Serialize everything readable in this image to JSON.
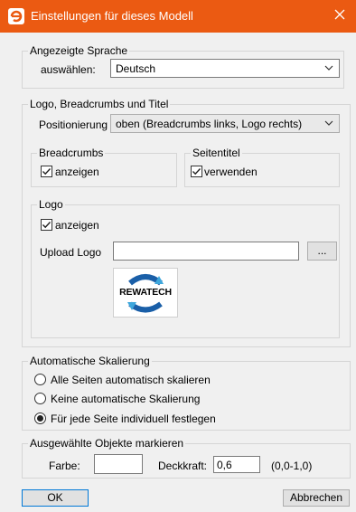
{
  "window": {
    "title": "Einstellungen für dieses Modell",
    "close_icon": "close-icon"
  },
  "language": {
    "group_title": "Angezeigte Sprache",
    "select_label": "auswählen:",
    "selected": "Deutsch"
  },
  "logo_section": {
    "group_title": "Logo, Breadcrumbs und Titel",
    "position_label": "Positionierung",
    "position_selected": "oben (Breadcrumbs links, Logo rechts)",
    "breadcrumbs": {
      "group_title": "Breadcrumbs",
      "checkbox_label": "anzeigen",
      "checked": true
    },
    "page_title": {
      "group_title": "Seitentitel",
      "checkbox_label": "verwenden",
      "checked": true
    },
    "logo": {
      "group_title": "Logo",
      "checkbox_label": "anzeigen",
      "checked": true,
      "upload_label": "Upload Logo",
      "upload_value": "",
      "browse_label": "...",
      "image_text": "REWATECH",
      "colors": {
        "arrow": "#1a5fa8",
        "arrow_light": "#3ea7dc"
      }
    }
  },
  "scaling": {
    "group_title": "Automatische Skalierung",
    "options": [
      {
        "label": "Alle Seiten automatisch skalieren",
        "selected": false
      },
      {
        "label": "Keine automatische Skalierung",
        "selected": false
      },
      {
        "label": "Für jede Seite individuell festlegen",
        "selected": true
      }
    ]
  },
  "highlight": {
    "group_title": "Ausgewählte Objekte markieren",
    "color_label": "Farbe:",
    "color_value": "",
    "opacity_label": "Deckkraft:",
    "opacity_value": "0,6",
    "range_hint": "(0,0-1,0)"
  },
  "buttons": {
    "ok": "OK",
    "cancel": "Abbrechen"
  },
  "colors": {
    "titlebar": "#eb5a12"
  }
}
